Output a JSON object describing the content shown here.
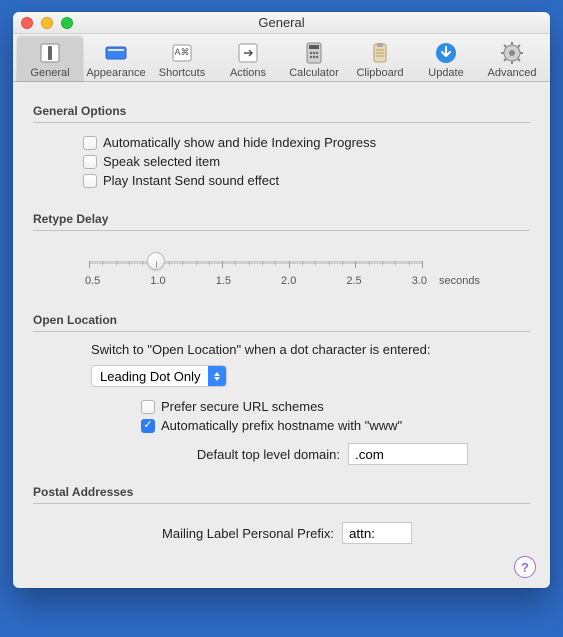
{
  "window": {
    "title": "General"
  },
  "toolbar": {
    "items": [
      {
        "label": "General"
      },
      {
        "label": "Appearance"
      },
      {
        "label": "Shortcuts"
      },
      {
        "label": "Actions"
      },
      {
        "label": "Calculator"
      },
      {
        "label": "Clipboard"
      },
      {
        "label": "Update"
      },
      {
        "label": "Advanced"
      }
    ]
  },
  "sections": {
    "general_options": {
      "title": "General Options",
      "opt1": "Automatically show and hide Indexing Progress",
      "opt2": "Speak selected item",
      "opt3": "Play Instant Send sound effect"
    },
    "retype": {
      "title": "Retype Delay",
      "labels": [
        "0.5",
        "1.0",
        "1.5",
        "2.0",
        "2.5",
        "3.0"
      ],
      "unit": "seconds",
      "value_pct": 20
    },
    "open_location": {
      "title": "Open Location",
      "prompt": "Switch to \"Open Location\" when a dot character is entered:",
      "select_value": "Leading Dot Only",
      "prefer_secure": "Prefer secure URL schemes",
      "prefix_www": "Automatically prefix hostname with \"www\"",
      "tld_label": "Default top level domain:",
      "tld_value": ".com"
    },
    "postal": {
      "title": "Postal Addresses",
      "label": "Mailing Label Personal Prefix:",
      "value": "attn:"
    }
  }
}
